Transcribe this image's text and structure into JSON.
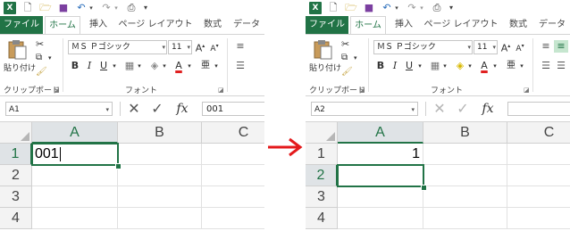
{
  "colors": {
    "accent": "#217346",
    "arrow": "#e41a1c"
  },
  "left": {
    "qat": {
      "icons": [
        "excel-logo",
        "new-file-icon",
        "open-file-icon",
        "save-icon",
        "undo-icon",
        "dropdown-icon",
        "redo-icon",
        "dropdown-icon",
        "print-preview-icon",
        "customize-icon"
      ]
    },
    "tabs": [
      {
        "label": "ファイル"
      },
      {
        "label": "ホーム"
      },
      {
        "label": "挿入"
      },
      {
        "label": "ページ レイアウト"
      },
      {
        "label": "数式"
      },
      {
        "label": "データ"
      }
    ],
    "ribbon": {
      "paste_label": "貼り付け",
      "clipboard_label": "クリップボード",
      "font_name": "ＭＳ Ｐゴシック",
      "font_size": "11",
      "font_group_label": "フォント",
      "bold": "B",
      "italic": "I",
      "underline": "U",
      "grow": "A",
      "shrink": "A"
    },
    "formula_bar": {
      "name_box": "A1",
      "fx": "fx",
      "input": "001"
    },
    "grid": {
      "columns": [
        "A",
        "B",
        "C"
      ],
      "rows": [
        "1",
        "2",
        "3",
        "4"
      ],
      "cell_a1": "001"
    }
  },
  "right": {
    "qat": {
      "icons": [
        "excel-logo",
        "new-file-icon",
        "open-file-icon",
        "save-icon",
        "undo-icon",
        "dropdown-icon",
        "redo-icon",
        "dropdown-icon",
        "print-preview-icon",
        "customize-icon"
      ]
    },
    "tabs": [
      {
        "label": "ファイル"
      },
      {
        "label": "ホーム"
      },
      {
        "label": "挿入"
      },
      {
        "label": "ページ レイアウト"
      },
      {
        "label": "数式"
      },
      {
        "label": "データ"
      }
    ],
    "ribbon": {
      "paste_label": "貼り付け",
      "clipboard_label": "クリップボード",
      "font_name": "ＭＳ Ｐゴシック",
      "font_size": "11",
      "font_group_label": "フォント",
      "bold": "B",
      "italic": "I",
      "underline": "U",
      "grow": "A",
      "shrink": "A"
    },
    "formula_bar": {
      "name_box": "A2",
      "fx": "fx",
      "input": ""
    },
    "grid": {
      "columns": [
        "A",
        "B",
        "C"
      ],
      "rows": [
        "1",
        "2",
        "3",
        "4"
      ],
      "cell_a1": "1"
    }
  }
}
